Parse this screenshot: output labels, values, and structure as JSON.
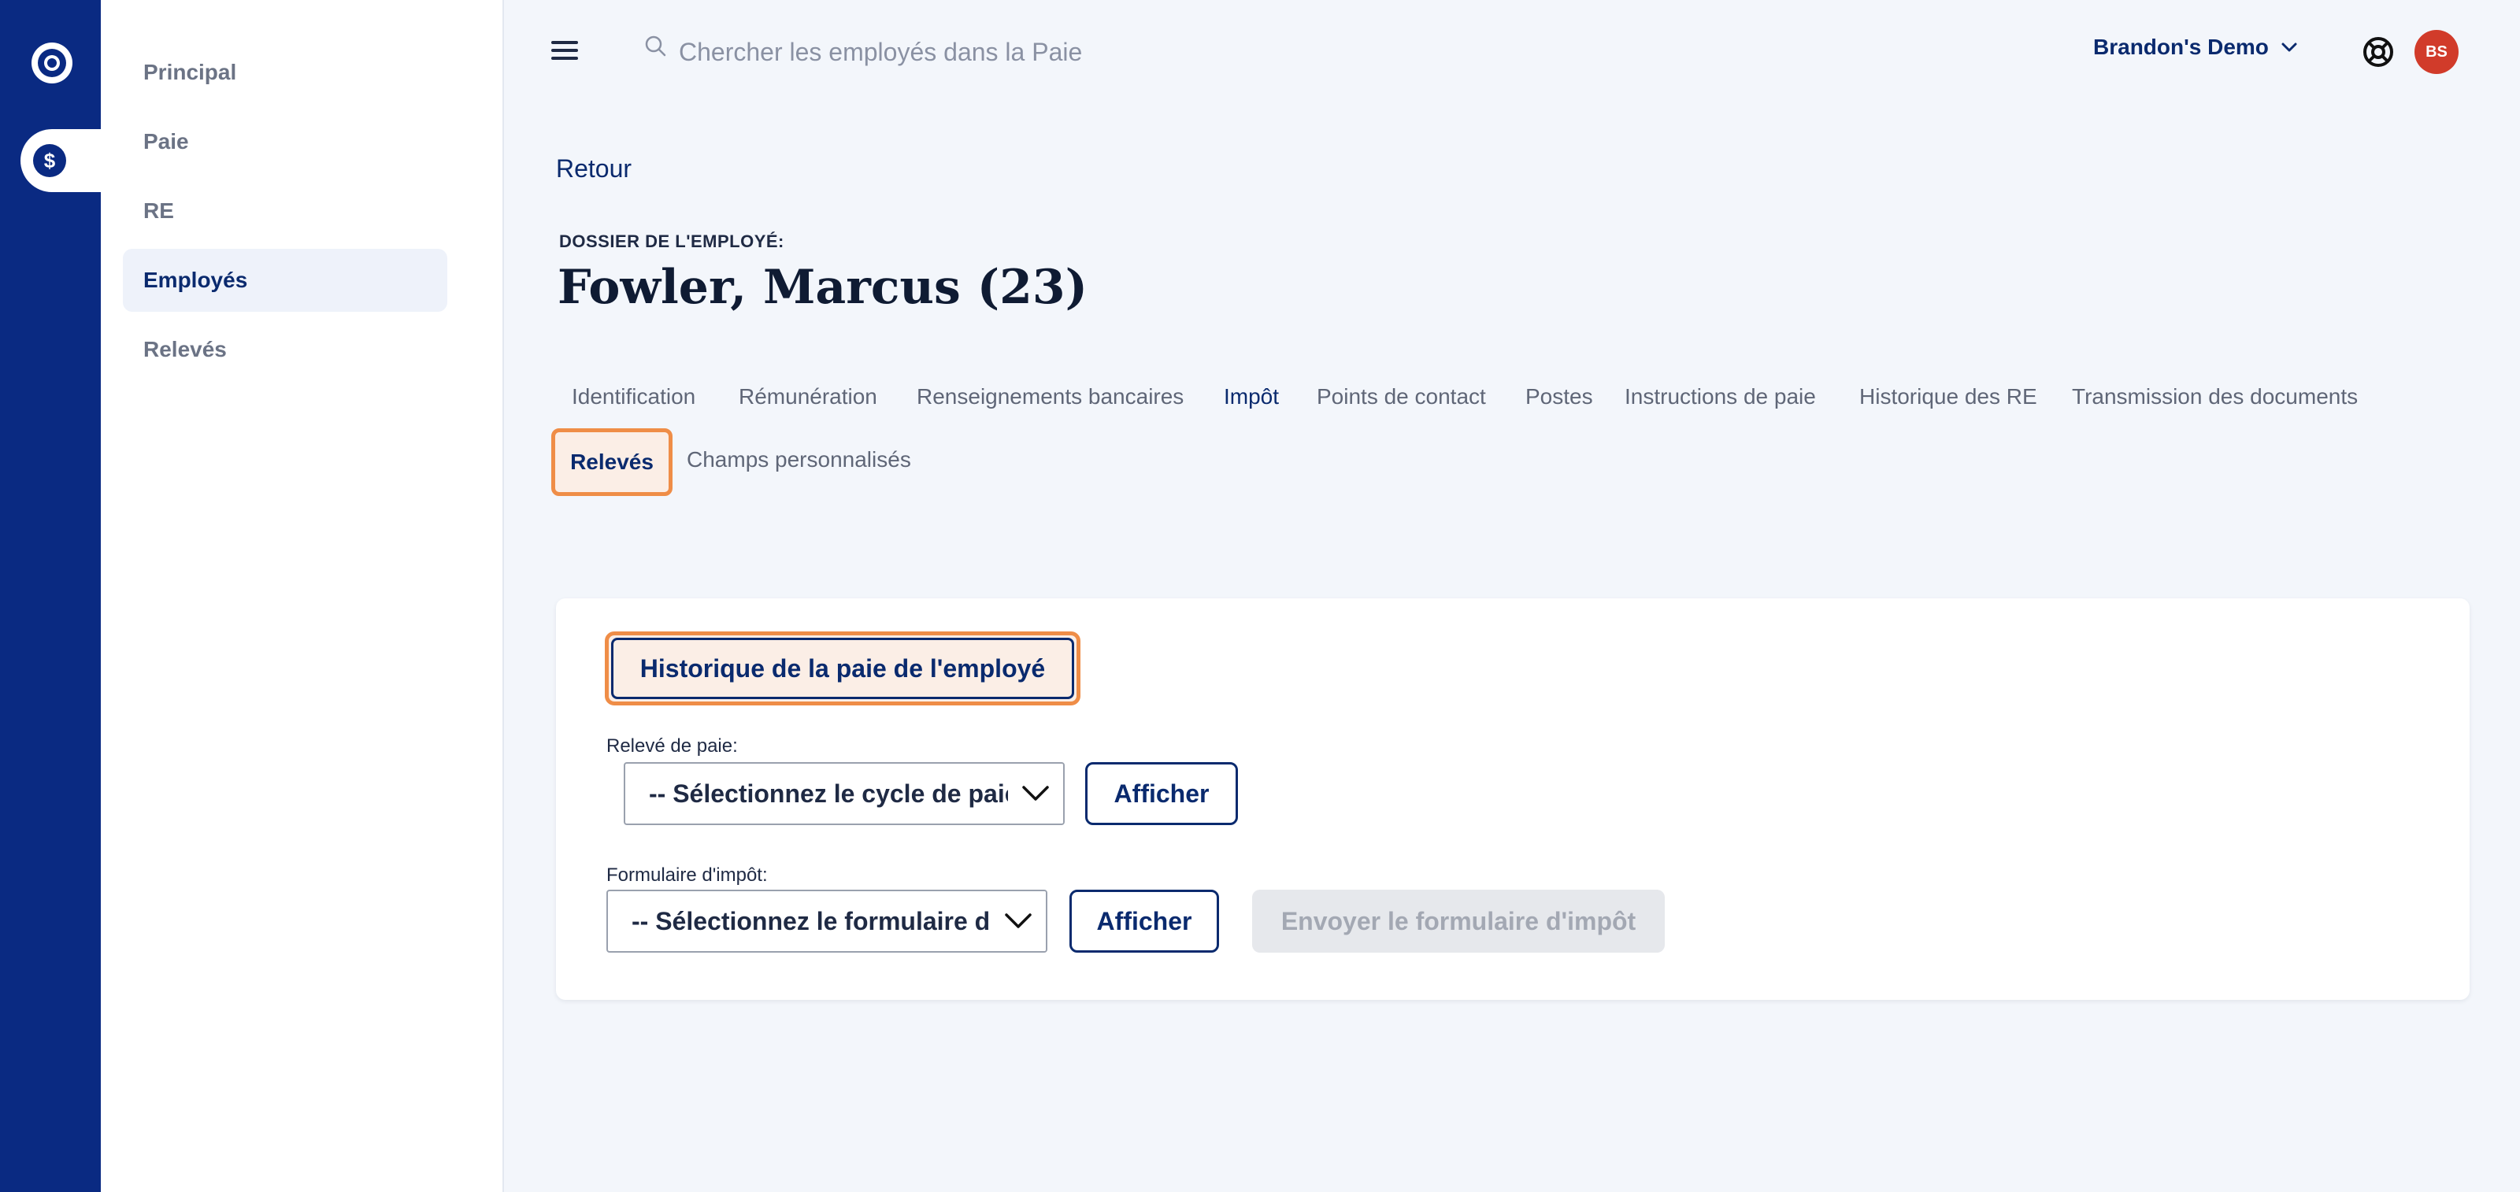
{
  "rail": {
    "logo_icon": "ring-logo-icon",
    "payroll_icon": "dollar-coin-icon"
  },
  "sidebar": {
    "items": [
      {
        "label": "Principal"
      },
      {
        "label": "Paie"
      },
      {
        "label": "RE"
      },
      {
        "label": "Employés",
        "active": true
      },
      {
        "label": "Relevés"
      }
    ]
  },
  "topbar": {
    "search_placeholder": "Chercher les employés dans la Paie",
    "company": "Brandon's Demo",
    "avatar_initials": "BS"
  },
  "page": {
    "back": "Retour",
    "file_label": "DOSSIER DE L'EMPLOYÉ:",
    "title": "Fowler, Marcus (23)"
  },
  "tabs": [
    "Identification",
    "Rémunération",
    "Renseignements bancaires",
    "Impôt",
    "Points de contact",
    "Postes",
    "Instructions de paie",
    "Historique des RE",
    "Transmission des documents",
    "Relevés",
    "Champs personnalisés"
  ],
  "active_tab": "Relevés",
  "card": {
    "history_button": "Historique de la paie de l'employé",
    "pay_stub_label": "Relevé de paie:",
    "pay_cycle_select": "-- Sélectionnez le cycle de paie --",
    "show_button": "Afficher",
    "tax_form_label": "Formulaire d'impôt:",
    "tax_form_select": "-- Sélectionnez le formulaire d'impôt --",
    "send_button": "Envoyer le formulaire d'impôt"
  },
  "colors": {
    "rail": "#0a2a82",
    "accent_text": "#0a2a6e",
    "highlight": "#ef8d47",
    "avatar": "#d13b2a"
  }
}
